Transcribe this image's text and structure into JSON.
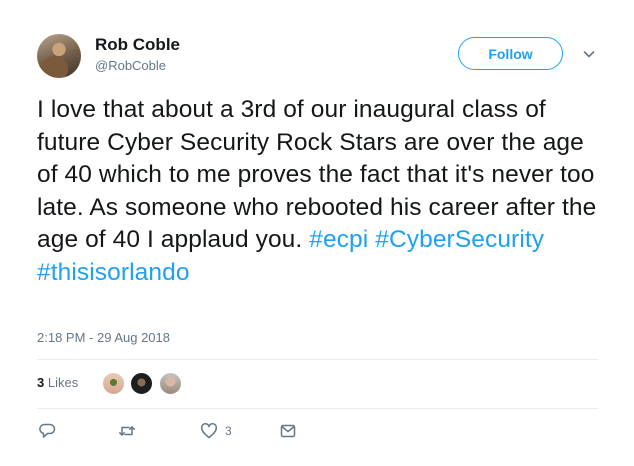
{
  "user": {
    "name": "Rob Coble",
    "handle": "@RobCoble"
  },
  "follow_label": "Follow",
  "tweet": {
    "text_plain": "I love that about a 3rd of our inaugural class of future Cyber Security Rock Stars are over the age of 40 which to me proves the fact that it's never too late. As someone who rebooted his career after the age of 40 I applaud you.",
    "hashtags": [
      "#ecpi",
      "#CyberSecurity",
      "#thisisorlando"
    ]
  },
  "timestamp": "2:18 PM - 29 Aug 2018",
  "likes": {
    "count": "3",
    "label": "Likes"
  },
  "actions": {
    "like_count": "3"
  },
  "colors": {
    "accent": "#1da1f2",
    "secondary_text": "#657786",
    "divider": "#e6ecf0"
  }
}
